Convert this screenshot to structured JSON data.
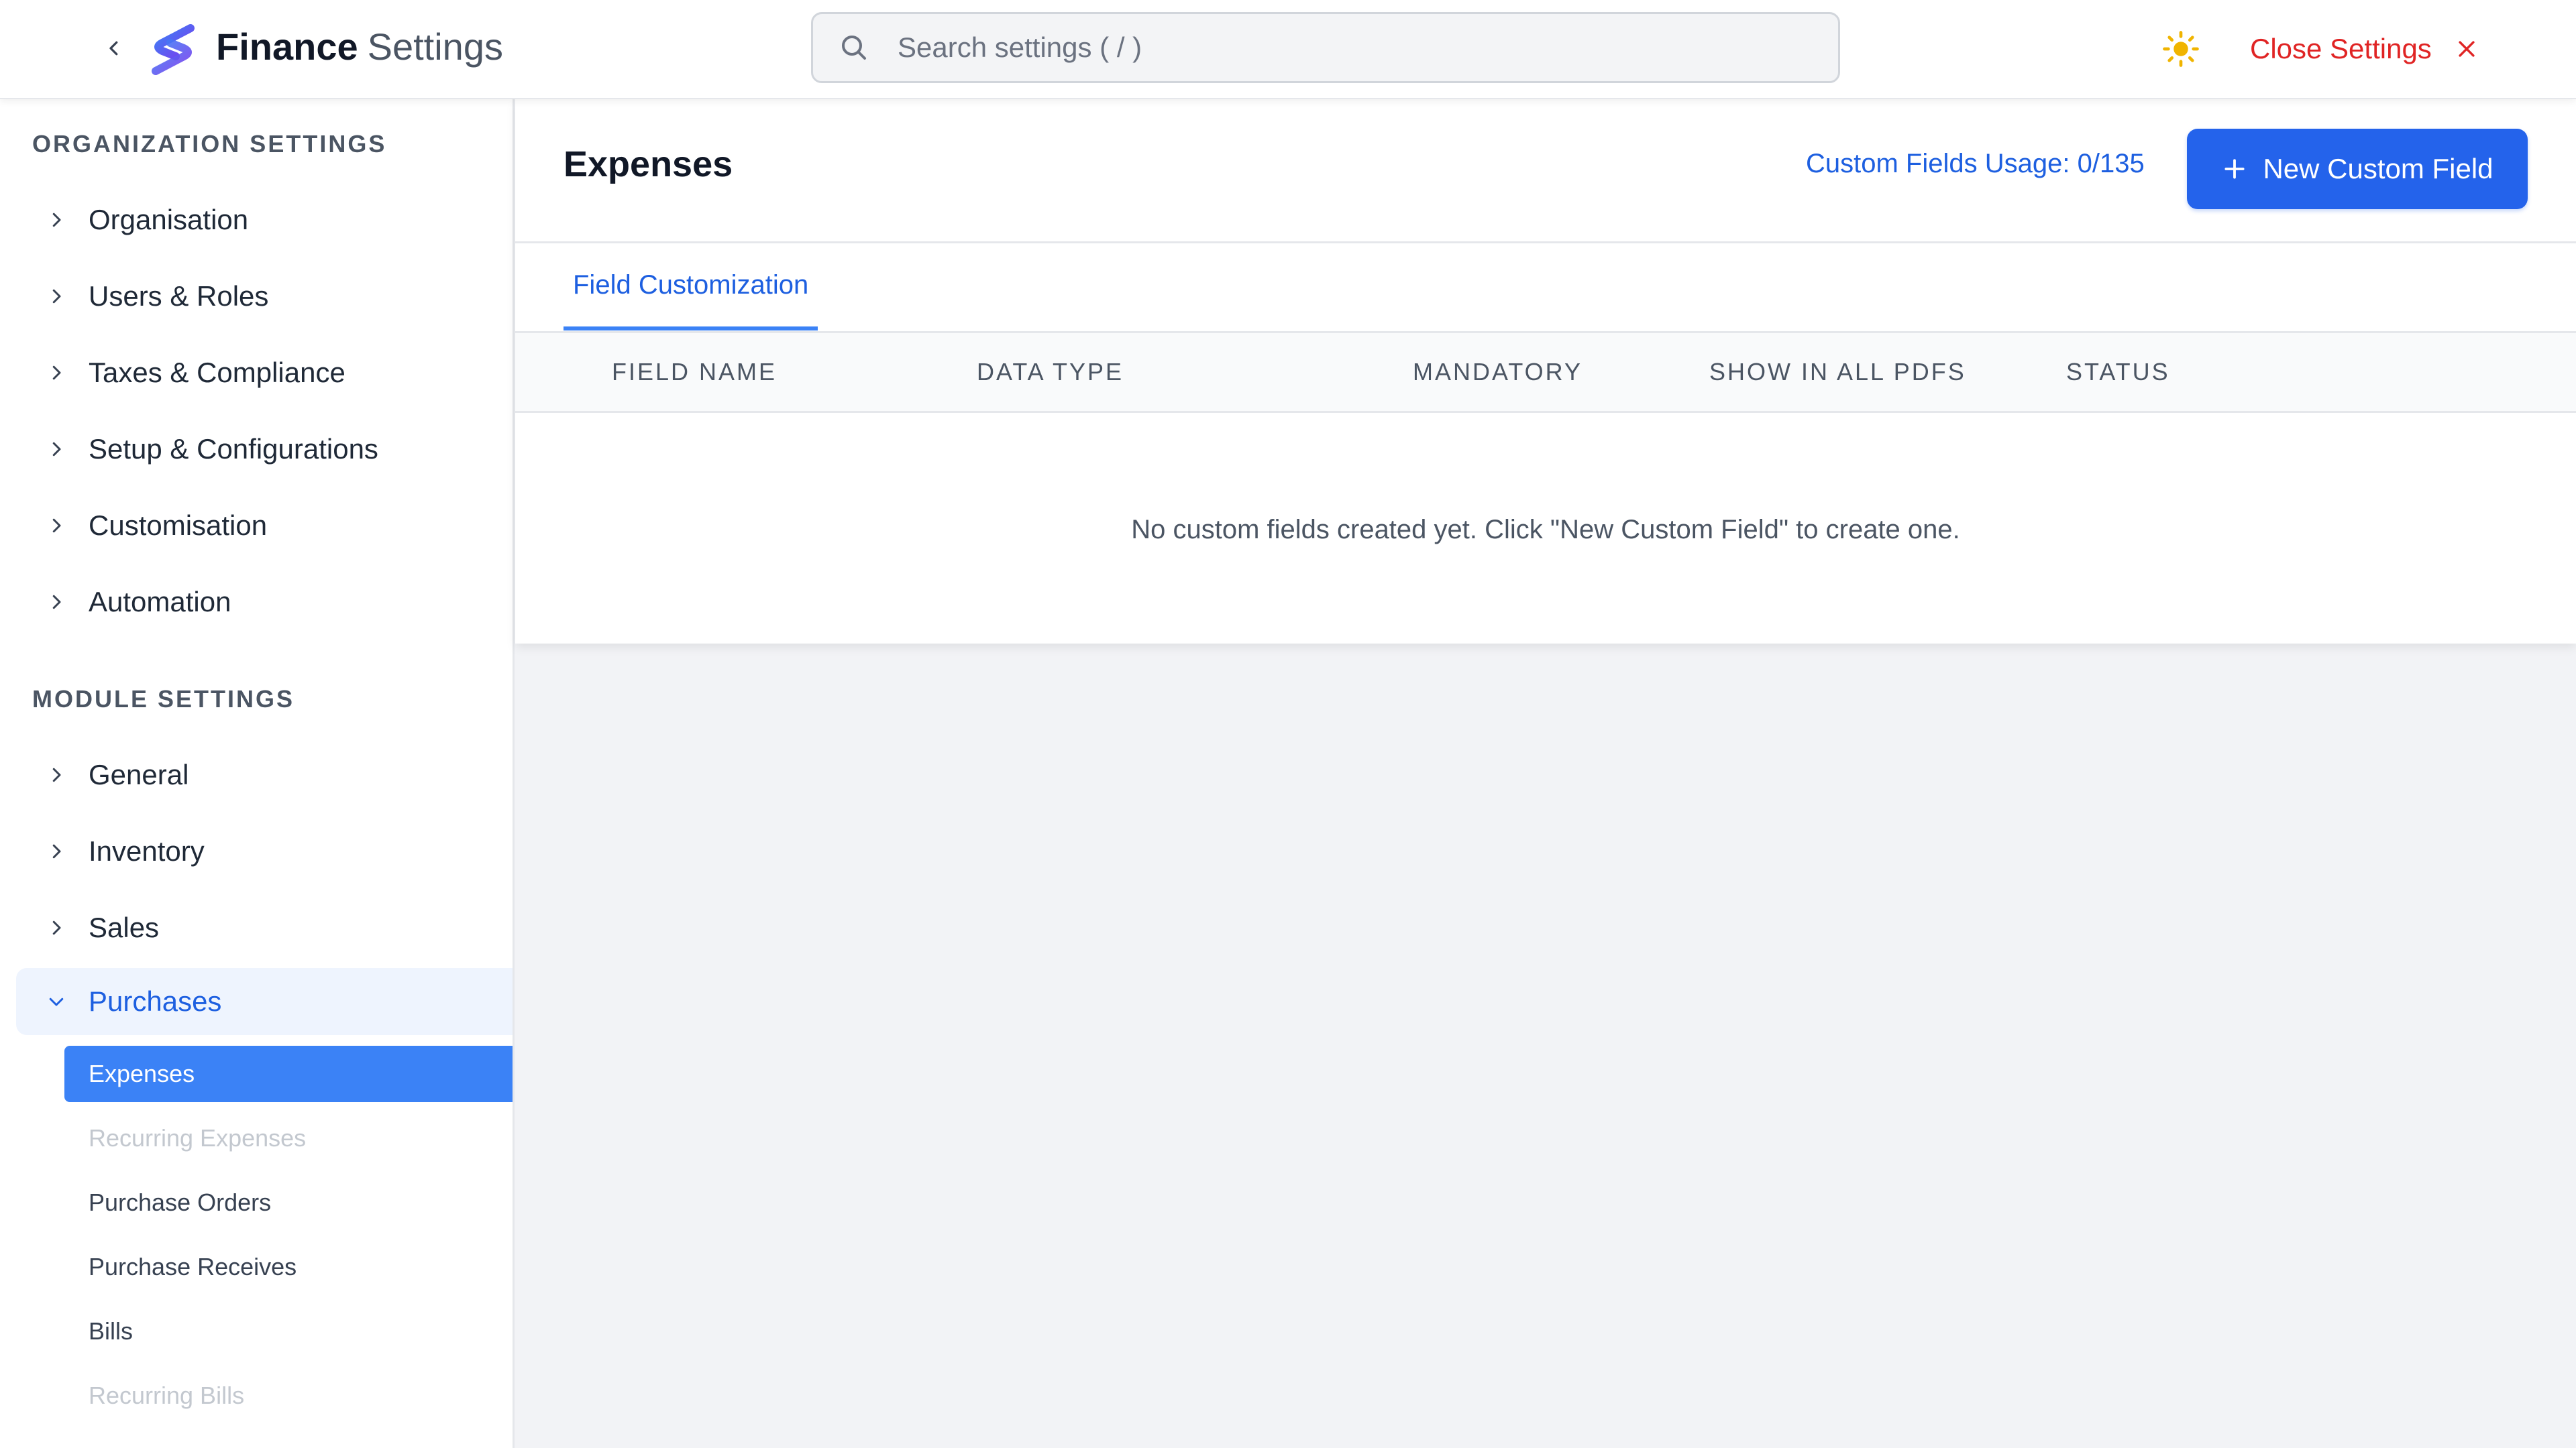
{
  "header": {
    "app_name": "Finance",
    "app_suffix": "Settings",
    "search_placeholder": "Search settings ( / )",
    "close_label": "Close Settings",
    "icons": {
      "back": "chevron-left-icon",
      "theme": "sun-icon",
      "search": "search-icon",
      "close": "close-icon"
    },
    "colors": {
      "close": "#e02424",
      "theme": "#f0b400",
      "logo_top": "#3b82f6",
      "logo_bottom": "#7c3aed"
    }
  },
  "sidebar": {
    "org_title": "ORGANIZATION SETTINGS",
    "org_items": [
      {
        "label": "Organisation"
      },
      {
        "label": "Users & Roles"
      },
      {
        "label": "Taxes & Compliance"
      },
      {
        "label": "Setup & Configurations"
      },
      {
        "label": "Customisation"
      },
      {
        "label": "Automation"
      }
    ],
    "module_title": "MODULE SETTINGS",
    "module_items": [
      {
        "label": "General"
      },
      {
        "label": "Inventory"
      },
      {
        "label": "Sales"
      },
      {
        "label": "Purchases",
        "expanded": true
      }
    ],
    "purchases_sub": [
      {
        "label": "Expenses",
        "selected": true
      },
      {
        "label": "Recurring Expenses",
        "muted": true
      },
      {
        "label": "Purchase Orders"
      },
      {
        "label": "Purchase Receives"
      },
      {
        "label": "Bills"
      },
      {
        "label": "Recurring Bills",
        "muted": true
      }
    ]
  },
  "main": {
    "title": "Expenses",
    "usage": "Custom Fields Usage: 0/135",
    "new_button": "New Custom Field",
    "tab": "Field Customization",
    "columns": [
      "FIELD NAME",
      "DATA TYPE",
      "MANDATORY",
      "SHOW IN ALL PDFS",
      "STATUS"
    ],
    "empty_message": "No custom fields created yet. Click \"New Custom Field\" to create one.",
    "colors": {
      "primary": "#2463eb",
      "link": "#1d5fe0",
      "selected_bg": "#3b82f6"
    }
  }
}
